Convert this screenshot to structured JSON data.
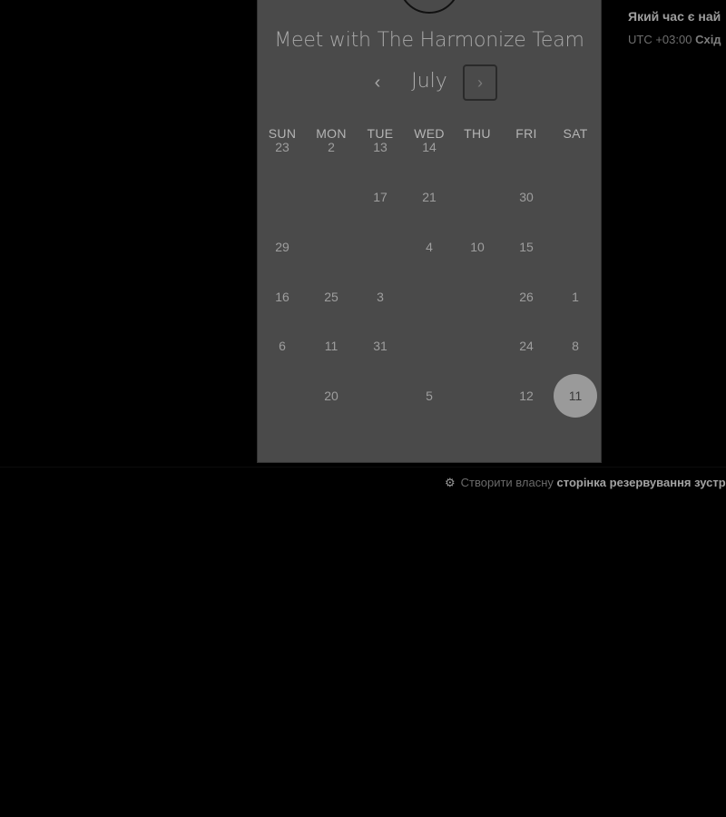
{
  "panel": {
    "title": "Meet with The Harmonize Team",
    "month": "July",
    "prev_icon": "chevron-left-icon",
    "next_icon": "chevron-right-icon",
    "prev_glyph": "‹",
    "next_glyph": "›"
  },
  "weekdays": [
    "SUN",
    "MON",
    "TUE",
    "WED",
    "THU",
    "FRI",
    "SAT"
  ],
  "days": [
    {
      "label": "23",
      "row": 0,
      "col": 0
    },
    {
      "label": "2",
      "row": 0,
      "col": 1
    },
    {
      "label": "13",
      "row": 0,
      "col": 2
    },
    {
      "label": "14",
      "row": 0,
      "col": 3
    },
    {
      "label": "17",
      "row": 1,
      "col": 2
    },
    {
      "label": "21",
      "row": 1,
      "col": 3
    },
    {
      "label": "30",
      "row": 1,
      "col": 5
    },
    {
      "label": "29",
      "row": 2,
      "col": 0
    },
    {
      "label": "4",
      "row": 2,
      "col": 3
    },
    {
      "label": "10",
      "row": 2,
      "col": 4
    },
    {
      "label": "15",
      "row": 2,
      "col": 5
    },
    {
      "label": "16",
      "row": 3,
      "col": 0
    },
    {
      "label": "25",
      "row": 3,
      "col": 1
    },
    {
      "label": "3",
      "row": 3,
      "col": 2
    },
    {
      "label": "26",
      "row": 3,
      "col": 5
    },
    {
      "label": "1",
      "row": 3,
      "col": 6
    },
    {
      "label": "6",
      "row": 4,
      "col": 0
    },
    {
      "label": "11",
      "row": 4,
      "col": 1
    },
    {
      "label": "31",
      "row": 4,
      "col": 2
    },
    {
      "label": "24",
      "row": 4,
      "col": 5
    },
    {
      "label": "8",
      "row": 4,
      "col": 6
    },
    {
      "label": "20",
      "row": 5,
      "col": 1
    },
    {
      "label": "5",
      "row": 5,
      "col": 3
    },
    {
      "label": "12",
      "row": 5,
      "col": 5
    },
    {
      "label": "11",
      "row": 5,
      "col": 6,
      "selected": true
    }
  ],
  "side": {
    "question": "Який час є най",
    "tz_prefix": "UTC +03:00",
    "tz_name": "Схід"
  },
  "footer": {
    "icon": "hubspot-sprocket-icon",
    "icon_glyph": "⚙",
    "prefix": "Створити власну",
    "link": "сторінка резервування зустр"
  },
  "colors": {
    "background": "#000000",
    "panel": "#4a4a4a",
    "selected_day": "#9a9a9a"
  }
}
